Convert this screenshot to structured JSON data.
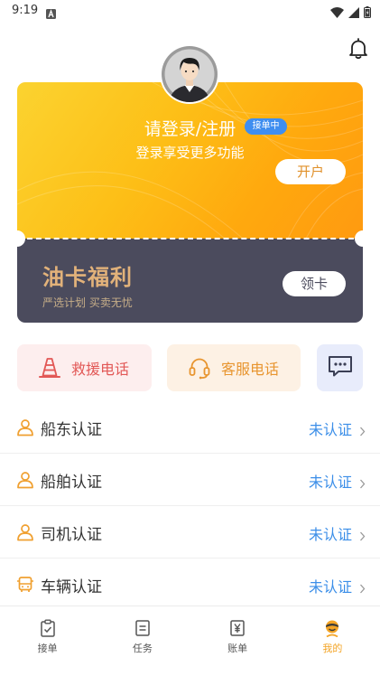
{
  "status_bar": {
    "time": "9:19",
    "icons": [
      "notification-a-icon",
      "wifi-icon",
      "signal-icon",
      "battery-icon"
    ]
  },
  "header": {
    "bell_icon": "bell-icon"
  },
  "profile": {
    "title": "请登录/注册",
    "badge": "接单中",
    "subtitle": "登录享受更多功能",
    "open_account_label": "开户"
  },
  "fuel_card": {
    "title": "油卡福利",
    "subtitle": "严选计划 买卖无忧",
    "claim_label": "领卡"
  },
  "quick_actions": {
    "rescue_label": "救援电话",
    "rescue_icon": "traffic-cone-icon",
    "service_label": "客服电话",
    "service_icon": "headset-icon",
    "chat_icon": "chat-bubble-icon"
  },
  "certifications": [
    {
      "label": "船东认证",
      "status": "未认证",
      "icon": "person-icon"
    },
    {
      "label": "船舶认证",
      "status": "未认证",
      "icon": "person-icon"
    },
    {
      "label": "司机认证",
      "status": "未认证",
      "icon": "person-icon"
    },
    {
      "label": "车辆认证",
      "status": "未认证",
      "icon": "bus-icon"
    }
  ],
  "bottom_nav": [
    {
      "label": "接单",
      "icon": "clipboard-check-icon",
      "active": false
    },
    {
      "label": "任务",
      "icon": "document-list-icon",
      "active": false
    },
    {
      "label": "账单",
      "icon": "yen-bill-icon",
      "active": false
    },
    {
      "label": "我的",
      "icon": "user-profile-icon",
      "active": true
    }
  ],
  "colors": {
    "orange": "#f3a425",
    "blue": "#3b8ee8",
    "dark": "#4b4b5d",
    "gold": "#e2b27a",
    "rescue-bg": "#fdeeee",
    "rescue-text": "#e25856",
    "service-bg": "#fdf1e4",
    "service-text": "#e8952f",
    "chat-bg": "#e8ecfb"
  }
}
